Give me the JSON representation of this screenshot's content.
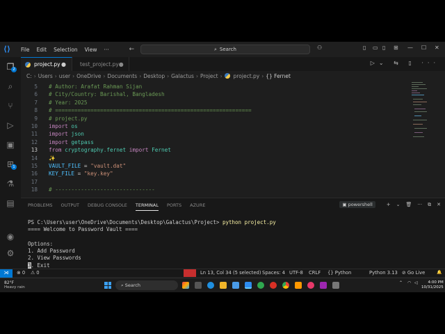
{
  "titlebar": {
    "menu": [
      "File",
      "Edit",
      "Selection",
      "View"
    ],
    "more": "···",
    "nav": "← →",
    "search_placeholder": "Search",
    "window_controls": [
      "—",
      "☐",
      "✕"
    ]
  },
  "tabs": [
    {
      "label": "project.py",
      "modified": "●"
    },
    {
      "label": "test_project.py",
      "close": "●"
    }
  ],
  "breadcrumb": [
    "C:",
    "Users",
    "user",
    "OneDrive",
    "Documents",
    "Desktop",
    "Galactus",
    "Project",
    "project.py",
    "{} Fernet"
  ],
  "activity_badges": {
    "explorer": "2",
    "extensions": "1"
  },
  "editor": {
    "current_line": 13,
    "lines": [
      {
        "n": "5",
        "segs": [
          {
            "c": "cmt",
            "t": "# Author: Arafat Rahman Sijan"
          }
        ]
      },
      {
        "n": "6",
        "segs": [
          {
            "c": "cmt",
            "t": "# City/Country: Barishal, Bangladesh"
          }
        ]
      },
      {
        "n": "7",
        "segs": [
          {
            "c": "cmt",
            "t": "# Year: 2025"
          }
        ]
      },
      {
        "n": "8",
        "segs": [
          {
            "c": "cmt",
            "t": "# ============================================================="
          }
        ]
      },
      {
        "n": "9",
        "segs": [
          {
            "c": "cmt",
            "t": "# project.py"
          }
        ]
      },
      {
        "n": "10",
        "segs": [
          {
            "c": "kw",
            "t": "import"
          },
          {
            "c": "txt",
            "t": " "
          },
          {
            "c": "fn",
            "t": "os"
          }
        ]
      },
      {
        "n": "11",
        "segs": [
          {
            "c": "kw",
            "t": "import"
          },
          {
            "c": "txt",
            "t": " "
          },
          {
            "c": "fn",
            "t": "json"
          }
        ]
      },
      {
        "n": "12",
        "segs": [
          {
            "c": "kw",
            "t": "import"
          },
          {
            "c": "txt",
            "t": " "
          },
          {
            "c": "fn",
            "t": "getpass"
          }
        ]
      },
      {
        "n": "13",
        "segs": [
          {
            "c": "kw",
            "t": "from"
          },
          {
            "c": "txt",
            "t": " "
          },
          {
            "c": "fn",
            "t": "cryptography.fernet"
          },
          {
            "c": "txt",
            "t": " "
          },
          {
            "c": "kw",
            "t": "import"
          },
          {
            "c": "txt",
            "t": " "
          },
          {
            "c": "fn",
            "t": "Fernet"
          }
        ]
      },
      {
        "n": "14",
        "segs": [
          {
            "c": "sparkle",
            "t": "✨"
          }
        ]
      },
      {
        "n": "15",
        "segs": [
          {
            "c": "var",
            "t": "VAULT_FILE"
          },
          {
            "c": "txt",
            "t": " = "
          },
          {
            "c": "str",
            "t": "\"vault.dat\""
          }
        ]
      },
      {
        "n": "16",
        "segs": [
          {
            "c": "var",
            "t": "KEY_FILE"
          },
          {
            "c": "txt",
            "t": " = "
          },
          {
            "c": "str",
            "t": "\"key.key\""
          }
        ]
      },
      {
        "n": "17",
        "segs": []
      },
      {
        "n": "18",
        "segs": [
          {
            "c": "cmt",
            "t": "# -------------------------------"
          }
        ]
      }
    ]
  },
  "panel": {
    "tabs": [
      "PROBLEMS",
      "OUTPUT",
      "DEBUG CONSOLE",
      "TERMINAL",
      "PORTS",
      "AZURE"
    ],
    "active_tab": "TERMINAL",
    "shell": "powershell",
    "actions": [
      "+",
      "⌄",
      "🗑",
      "···",
      "⧉",
      "✕"
    ],
    "terminal": {
      "prompt": "PS C:\\Users\\user\\OneDrive\\Documents\\Desktop\\Galactus\\Project> ",
      "command": "python project.py",
      "lines": [
        "==== Welcome to Password Vault ====",
        "",
        "Options:",
        "1. Add Password",
        "2. View Passwords"
      ],
      "last_cursor": "3",
      "last_rest": ". Exit"
    }
  },
  "statusbar": {
    "errors": "⊗ 0",
    "warnings": "⚠ 0",
    "position": "Ln 13, Col 34 (5 selected)",
    "spaces": "Spaces: 4",
    "encoding": "UTF-8",
    "eol": "CRLF",
    "language": "{} Python",
    "interpreter": "Python 3.13",
    "golive": "⊘ Go Live",
    "bell": "🔔"
  },
  "taskbar": {
    "temp": "82°F",
    "weather": "Heavy rain",
    "search": "Search",
    "time": "4:00 PM",
    "date": "10/31/2025"
  },
  "colors": {
    "accent": "#0078d4",
    "comment": "#6a9955",
    "keyword": "#c586c0",
    "string": "#ce9178",
    "variable": "#4fc1ff"
  }
}
